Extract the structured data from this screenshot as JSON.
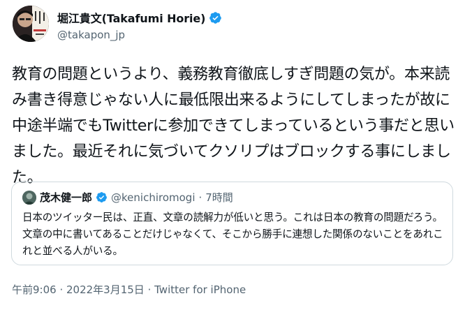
{
  "author": {
    "name": "堀江貴文(Takafumi Horie)",
    "handle": "@takapon_jp"
  },
  "tweet": {
    "text": "教育の問題というより、義務教育徹底しすぎ問題の気が。本来読み書き得意じゃない人に最低限出来るようにしてしまったが故に中途半端でもTwitterに参加できてしまっているという事だと思いました。最近それに気づいてクソリプはブロックする事にしました。"
  },
  "quoted": {
    "name": "茂木健一郎",
    "handle": "@kenichiromogi",
    "separator": "·",
    "time": "7時間",
    "text": "日本のツイッター民は、正直、文章の読解力が低いと思う。これは日本の教育の問題だろう。文章の中に書いてあることだけじゃなくて、そこから勝手に連想した関係のないことをあれこれと並べる人がいる。"
  },
  "meta": {
    "time": "午前9:06",
    "sep1": " · ",
    "date": "2022年3月15日",
    "sep2": " · ",
    "source": "Twitter for iPhone"
  },
  "colors": {
    "verified": "#1d9bf0",
    "secondary_text": "#536471",
    "border": "#cfd9de"
  }
}
